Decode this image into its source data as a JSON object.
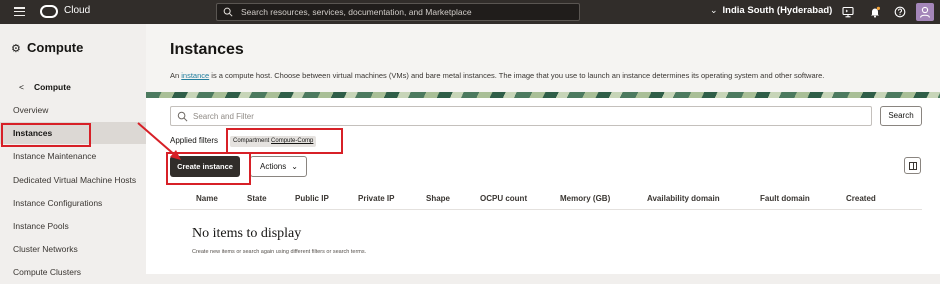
{
  "topbar": {
    "brand": "Cloud",
    "search_placeholder": "Search resources, services, documentation, and Marketplace",
    "region": "India South (Hyderabad)",
    "icons": [
      "hamburger-icon",
      "oracle-logo",
      "search-icon",
      "chevron-down-icon",
      "developer-tools-icon",
      "notifications-bell-icon",
      "help-icon",
      "user-avatar-icon"
    ]
  },
  "sidebar": {
    "title": "Compute",
    "back_label": "Compute",
    "items": [
      {
        "label": "Overview",
        "active": false
      },
      {
        "label": "Instances",
        "active": true
      },
      {
        "label": "Instance Maintenance",
        "active": false
      },
      {
        "label": "Dedicated Virtual Machine Hosts",
        "active": false
      },
      {
        "label": "Instance Configurations",
        "active": false
      },
      {
        "label": "Instance Pools",
        "active": false
      },
      {
        "label": "Cluster Networks",
        "active": false
      },
      {
        "label": "Compute Clusters",
        "active": false
      }
    ]
  },
  "main": {
    "title": "Instances",
    "desc_prefix": "An ",
    "desc_link": "instance",
    "desc_suffix": " is a compute host. Choose between virtual machines (VMs) and bare metal instances. The image that you use to launch an instance determines its operating system and other software.",
    "filter_placeholder": "Search and Filter",
    "search_button": "Search",
    "applied_filters_label": "Applied filters",
    "chip_key": "Compartment",
    "chip_value": "Compute-Comp",
    "create_button": "Create instance",
    "actions_button": "Actions",
    "columns": [
      "Name",
      "State",
      "Public IP",
      "Private IP",
      "Shape",
      "OCPU count",
      "Memory (GB)",
      "Availability domain",
      "Fault domain",
      "Created"
    ],
    "empty_title": "No items to display",
    "empty_subtitle": "Create new items or search again using different filters or search terms."
  },
  "colors": {
    "topbar_bg": "#312d2a",
    "sidebar_bg": "#f1efed",
    "primary_button": "#312d2a",
    "link": "#227e9e",
    "annotation_red": "#d72027"
  }
}
